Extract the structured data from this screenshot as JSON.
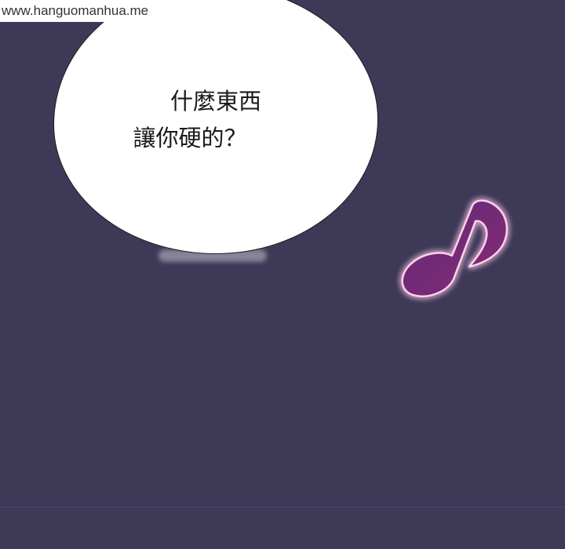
{
  "watermark": {
    "text": "www.hanguomanhua.me"
  },
  "bubble": {
    "line1": "什麼東西",
    "line2": "讓你硬的？"
  },
  "note_icon": "music-note-icon",
  "colors": {
    "background": "#3d3957",
    "bubble_fill": "#ffffff",
    "bubble_outline": "#1e1e1e",
    "note_fill": "#7a2a78",
    "note_glow": "#ff9ad8"
  }
}
